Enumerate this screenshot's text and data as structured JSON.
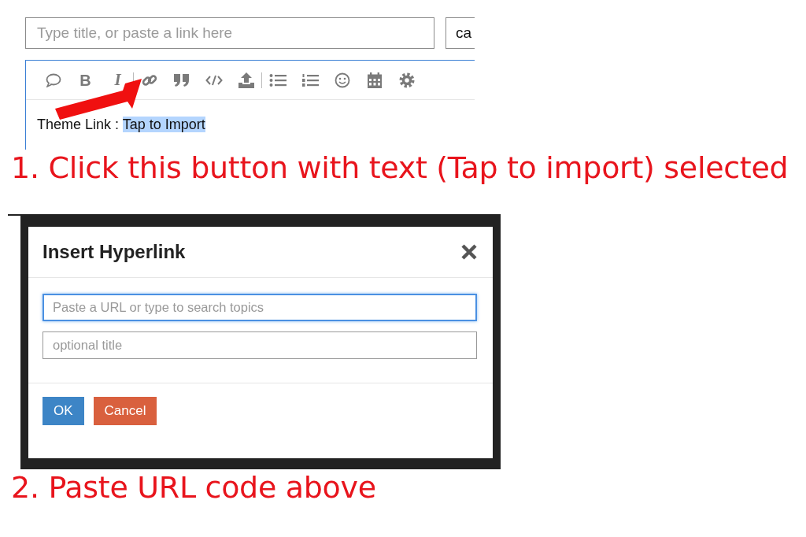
{
  "title_field": {
    "placeholder": "Type title, or paste a link here"
  },
  "category_field": {
    "value": "ca"
  },
  "toolbar": {
    "bold_glyph": "B",
    "italic_glyph": "I"
  },
  "editor": {
    "text": "Theme Link : ",
    "selected_text": "Tap to Import"
  },
  "step_1_caption": "1. Click this button with text (Tap to import) selected",
  "dialog": {
    "title": "Insert Hyperlink",
    "fields": [
      {
        "placeholder": "Paste a URL or type to search topics",
        "focused": true
      },
      {
        "placeholder": "optional title",
        "focused": false
      }
    ],
    "buttons": [
      {
        "label": "OK",
        "kind": "primary"
      },
      {
        "label": "Cancel",
        "kind": "danger"
      }
    ]
  },
  "step_2_caption": "2. Paste URL code above"
}
